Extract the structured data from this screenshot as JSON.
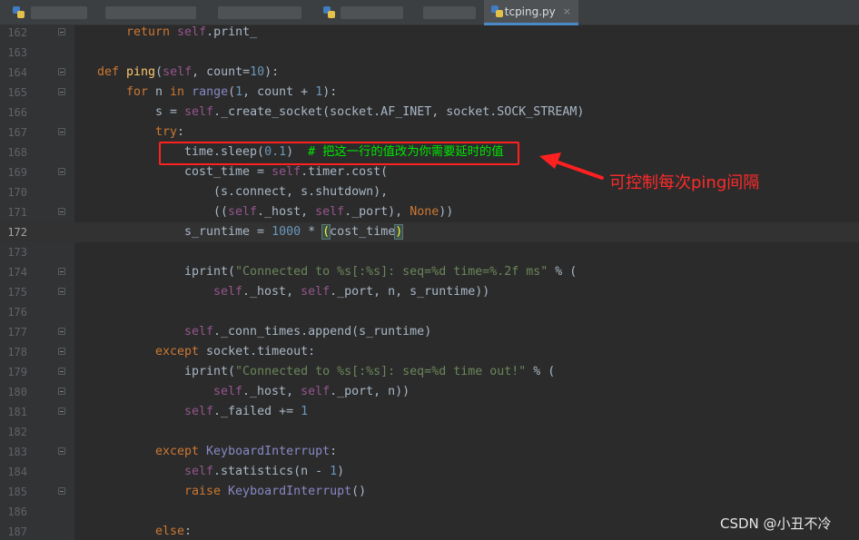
{
  "tabs": {
    "active_label": "tcping.py",
    "close_glyph": "×",
    "blurred_count": 4
  },
  "lines": [
    {
      "n": "162",
      "tokens": [
        [
          "kw",
          "return "
        ],
        [
          "slf",
          "self"
        ],
        [
          "plain",
          ".print_"
        ]
      ],
      "indent": 2,
      "fold": true
    },
    {
      "n": "163",
      "tokens": [],
      "indent": 0,
      "fold": false
    },
    {
      "n": "164",
      "tokens": [
        [
          "kw",
          "def "
        ],
        [
          "fn",
          "ping"
        ],
        [
          "plain",
          "("
        ],
        [
          "slf",
          "self"
        ],
        [
          "plain",
          ", count="
        ],
        [
          "num",
          "10"
        ],
        [
          "plain",
          "):"
        ]
      ],
      "indent": 1,
      "fold": true
    },
    {
      "n": "165",
      "tokens": [
        [
          "kw",
          "for "
        ],
        [
          "plain",
          "n "
        ],
        [
          "kw",
          "in "
        ],
        [
          "cls",
          "range"
        ],
        [
          "plain",
          "("
        ],
        [
          "num",
          "1"
        ],
        [
          "plain",
          ", count + "
        ],
        [
          "num",
          "1"
        ],
        [
          "plain",
          "):"
        ]
      ],
      "indent": 2,
      "fold": true
    },
    {
      "n": "166",
      "tokens": [
        [
          "plain",
          "s = "
        ],
        [
          "slf",
          "self"
        ],
        [
          "plain",
          "._create_socket(socket.AF_INET, socket.SOCK_STREAM)"
        ]
      ],
      "indent": 3,
      "fold": false
    },
    {
      "n": "167",
      "tokens": [
        [
          "kw",
          "try"
        ],
        [
          "plain",
          ":"
        ]
      ],
      "indent": 3,
      "fold": true
    },
    {
      "n": "168",
      "tokens": [
        [
          "plain",
          "time.sleep("
        ],
        [
          "num",
          "0.1"
        ],
        [
          "plain",
          ")  "
        ],
        [
          "cmt",
          "# 把这一行的值改为你需要延时的值"
        ]
      ],
      "indent": 4,
      "fold": false
    },
    {
      "n": "169",
      "tokens": [
        [
          "plain",
          "cost_time = "
        ],
        [
          "slf",
          "self"
        ],
        [
          "plain",
          ".timer.cost("
        ]
      ],
      "indent": 4,
      "fold": true
    },
    {
      "n": "170",
      "tokens": [
        [
          "plain",
          "(s.connect, s.shutdown),"
        ]
      ],
      "indent": 5,
      "fold": false
    },
    {
      "n": "171",
      "tokens": [
        [
          "plain",
          "(("
        ],
        [
          "slf",
          "self"
        ],
        [
          "plain",
          "._host, "
        ],
        [
          "slf",
          "self"
        ],
        [
          "plain",
          "._port), "
        ],
        [
          "kw",
          "None"
        ],
        [
          "plain",
          "))"
        ]
      ],
      "indent": 5,
      "fold": true
    },
    {
      "n": "172",
      "tokens": [
        [
          "plain",
          "s_runtime = "
        ],
        [
          "num",
          "1000"
        ],
        [
          "plain",
          " * "
        ],
        [
          "hl",
          "("
        ],
        [
          "plain",
          "cost_time"
        ],
        [
          "hl",
          ")"
        ]
      ],
      "indent": 4,
      "fold": false,
      "current": true
    },
    {
      "n": "173",
      "tokens": [],
      "indent": 0,
      "fold": false
    },
    {
      "n": "174",
      "tokens": [
        [
          "plain",
          "iprint("
        ],
        [
          "str",
          "\"Connected to %s[:%s]: seq=%d time=%.2f ms\""
        ],
        [
          "plain",
          " % ("
        ]
      ],
      "indent": 4,
      "fold": true
    },
    {
      "n": "175",
      "tokens": [
        [
          "slf",
          "self"
        ],
        [
          "plain",
          "._host, "
        ],
        [
          "slf",
          "self"
        ],
        [
          "plain",
          "._port, n, s_runtime))"
        ]
      ],
      "indent": 5,
      "fold": true
    },
    {
      "n": "176",
      "tokens": [],
      "indent": 0,
      "fold": false
    },
    {
      "n": "177",
      "tokens": [
        [
          "slf",
          "self"
        ],
        [
          "plain",
          "._conn_times.append(s_runtime)"
        ]
      ],
      "indent": 4,
      "fold": true
    },
    {
      "n": "178",
      "tokens": [
        [
          "kw",
          "except "
        ],
        [
          "plain",
          "socket.timeout:"
        ]
      ],
      "indent": 3,
      "fold": true
    },
    {
      "n": "179",
      "tokens": [
        [
          "plain",
          "iprint("
        ],
        [
          "str",
          "\"Connected to %s[:%s]: seq=%d time out!\""
        ],
        [
          "plain",
          " % ("
        ]
      ],
      "indent": 4,
      "fold": true
    },
    {
      "n": "180",
      "tokens": [
        [
          "slf",
          "self"
        ],
        [
          "plain",
          "._host, "
        ],
        [
          "slf",
          "self"
        ],
        [
          "plain",
          "._port, n))"
        ]
      ],
      "indent": 5,
      "fold": true
    },
    {
      "n": "181",
      "tokens": [
        [
          "slf",
          "self"
        ],
        [
          "plain",
          "._failed += "
        ],
        [
          "num",
          "1"
        ]
      ],
      "indent": 4,
      "fold": true
    },
    {
      "n": "182",
      "tokens": [],
      "indent": 0,
      "fold": false
    },
    {
      "n": "183",
      "tokens": [
        [
          "kw",
          "except "
        ],
        [
          "ex",
          "KeyboardInterrupt"
        ],
        [
          "plain",
          ":"
        ]
      ],
      "indent": 3,
      "fold": true
    },
    {
      "n": "184",
      "tokens": [
        [
          "slf",
          "self"
        ],
        [
          "plain",
          ".statistics(n - "
        ],
        [
          "num",
          "1"
        ],
        [
          "plain",
          ")"
        ]
      ],
      "indent": 4,
      "fold": false
    },
    {
      "n": "185",
      "tokens": [
        [
          "kw",
          "raise "
        ],
        [
          "ex",
          "KeyboardInterrupt"
        ],
        [
          "plain",
          "()"
        ]
      ],
      "indent": 4,
      "fold": true
    },
    {
      "n": "186",
      "tokens": [],
      "indent": 0,
      "fold": false
    },
    {
      "n": "187",
      "tokens": [
        [
          "kw",
          "else"
        ],
        [
          "plain",
          ":"
        ]
      ],
      "indent": 3,
      "fold": false
    }
  ],
  "annotation": {
    "text": "可控制每次ping间隔",
    "color": "#ff2020"
  },
  "watermark": "CSDN @小丑不冷",
  "colors": {
    "keyword": "#cc7832",
    "function": "#ffc66d",
    "self": "#94558d",
    "number": "#6897bb",
    "string": "#6a8759",
    "comment": "#00e600",
    "active_tab_underline": "#4a88c7"
  }
}
